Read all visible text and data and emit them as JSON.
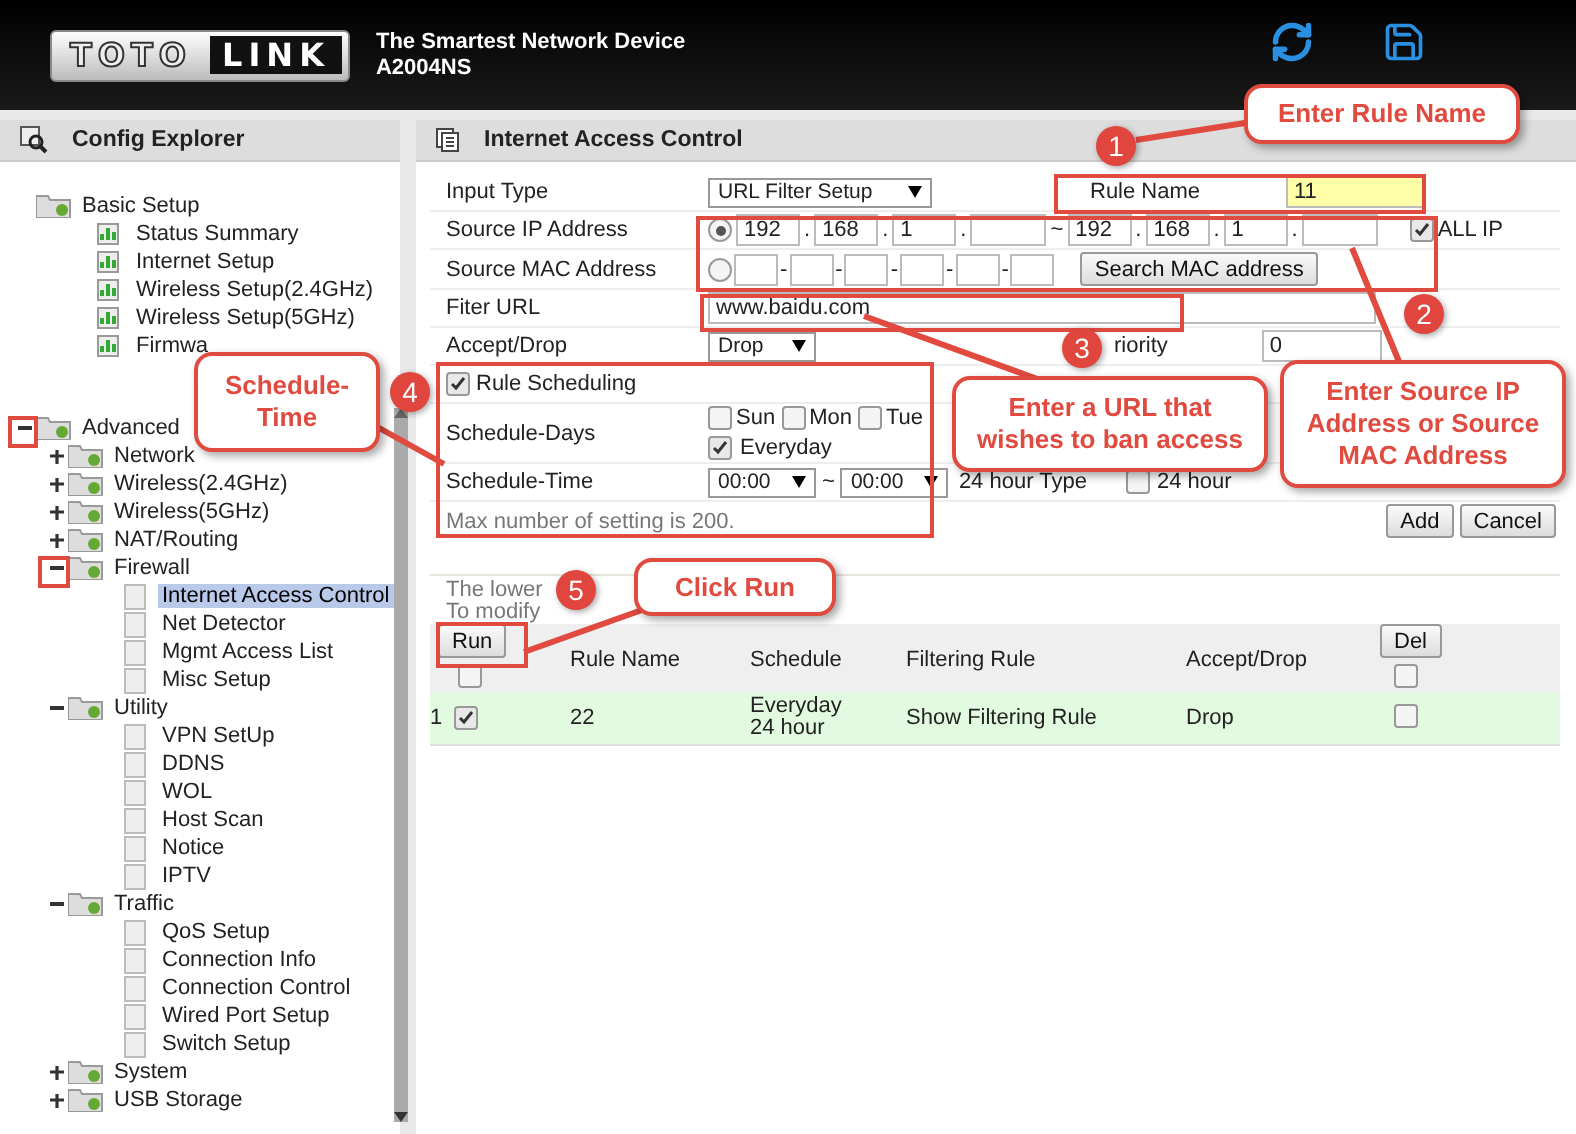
{
  "header": {
    "logo": {
      "left": "TOTO",
      "right": "LINK"
    },
    "tagline": "The Smartest Network Device",
    "model": "A2004NS"
  },
  "sidebar": {
    "title": "Config Explorer",
    "tree": [
      {
        "label": "Basic Setup",
        "kind": "group",
        "selected": false,
        "children": [
          {
            "label": "Status Summary",
            "kind": "item",
            "selected": false
          },
          {
            "label": "Internet Setup",
            "kind": "item",
            "selected": false
          },
          {
            "label": "Wireless Setup(2.4GHz)",
            "kind": "item",
            "selected": false
          },
          {
            "label": "Wireless Setup(5GHz)",
            "kind": "item",
            "selected": false
          },
          {
            "label": "Firmwa",
            "kind": "item",
            "selected": false
          }
        ]
      },
      {
        "label": "Advanced",
        "kind": "group",
        "expanded": true,
        "selected": false,
        "children": [
          {
            "label": "Network",
            "kind": "group",
            "expanded": false,
            "selected": false
          },
          {
            "label": "Wireless(2.4GHz)",
            "kind": "group",
            "expanded": false,
            "selected": false
          },
          {
            "label": "Wireless(5GHz)",
            "kind": "group",
            "expanded": false,
            "selected": false
          },
          {
            "label": "NAT/Routing",
            "kind": "group",
            "expanded": false,
            "selected": false
          },
          {
            "label": "Firewall",
            "kind": "group",
            "expanded": true,
            "selected": false,
            "children": [
              {
                "label": "Internet Access Control",
                "kind": "leaf",
                "selected": true
              },
              {
                "label": "Net Detector",
                "kind": "leaf",
                "selected": false
              },
              {
                "label": "Mgmt Access List",
                "kind": "leaf",
                "selected": false
              },
              {
                "label": "Misc Setup",
                "kind": "leaf",
                "selected": false
              }
            ]
          },
          {
            "label": "Utility",
            "kind": "group",
            "expanded": true,
            "selected": false,
            "children": [
              {
                "label": "VPN SetUp",
                "kind": "leaf",
                "selected": false
              },
              {
                "label": "DDNS",
                "kind": "leaf",
                "selected": false
              },
              {
                "label": "WOL",
                "kind": "leaf",
                "selected": false
              },
              {
                "label": "Host Scan",
                "kind": "leaf",
                "selected": false
              },
              {
                "label": "Notice",
                "kind": "leaf",
                "selected": false
              },
              {
                "label": "IPTV",
                "kind": "leaf",
                "selected": false
              }
            ]
          },
          {
            "label": "Traffic",
            "kind": "group",
            "expanded": true,
            "selected": false,
            "children": [
              {
                "label": "QoS Setup",
                "kind": "leaf",
                "selected": false
              },
              {
                "label": "Connection Info",
                "kind": "leaf",
                "selected": false
              },
              {
                "label": "Connection Control",
                "kind": "leaf",
                "selected": false
              },
              {
                "label": "Wired Port Setup",
                "kind": "leaf",
                "selected": false
              },
              {
                "label": "Switch Setup",
                "kind": "leaf",
                "selected": false
              }
            ]
          },
          {
            "label": "System",
            "kind": "group",
            "expanded": false,
            "selected": false
          },
          {
            "label": "USB Storage",
            "kind": "group",
            "expanded": false,
            "selected": false
          }
        ]
      }
    ]
  },
  "panel": {
    "title": "Internet Access Control",
    "input_type": {
      "label": "Input Type",
      "value": "URL Filter Setup"
    },
    "rule_name": {
      "label": "Rule Name",
      "value": "11"
    },
    "source_ip": {
      "label": "Source IP Address",
      "selected": true,
      "dot": ".",
      "range": "~",
      "start": [
        "192",
        "168",
        "1"
      ],
      "end": [
        "192",
        "168",
        "1"
      ]
    },
    "all_ip": {
      "label": "ALL IP",
      "checked": true
    },
    "source_mac": {
      "label": "Source MAC Address",
      "selected": false,
      "dash": "-",
      "button": "Search MAC address"
    },
    "filter_url": {
      "label": "Fiter URL",
      "value": "www.baidu.com"
    },
    "accept_drop": {
      "label": "Accept/Drop",
      "value": "Drop"
    },
    "priority": {
      "label": "riority",
      "value": "0"
    },
    "rule_scheduling": {
      "label": "Rule Scheduling",
      "checked": true
    },
    "schedule_days": {
      "label": "Schedule-Days",
      "days": [
        {
          "label": "Sun",
          "checked": false
        },
        {
          "label": "Mon",
          "checked": false
        },
        {
          "label": "Tue",
          "checked": false
        }
      ],
      "everyday": {
        "label": "Everyday",
        "checked": true
      }
    },
    "schedule_time": {
      "label": "Schedule-Time",
      "from": "00:00",
      "separator": "~",
      "to": "00:00",
      "type_label": "24 hour Type",
      "hour24": {
        "label": "24 hour",
        "checked": false
      }
    },
    "note": "Max number of setting is 200.",
    "buttons": [
      "Add",
      "Cancel"
    ],
    "hint": [
      "The lower",
      "To modify"
    ],
    "table": {
      "run": "Run",
      "del": "Del",
      "select_all": false,
      "delete_all": false,
      "columns": [
        "Rule Name",
        "Schedule",
        "Filtering Rule",
        "Accept/Drop"
      ],
      "rows": [
        {
          "index": "1",
          "checked": true,
          "rule_name": "22",
          "schedule": [
            "Everyday",
            "24 hour"
          ],
          "filtering_rule": "Show Filtering Rule",
          "action": "Drop",
          "delete": false
        }
      ]
    }
  },
  "annotations": [
    {
      "step": "1",
      "text": "Enter Rule Name"
    },
    {
      "step": "4",
      "text": "Schedule-Time"
    },
    {
      "step": "3",
      "text": "Enter a URL that wishes to ban access"
    },
    {
      "step": "2",
      "text": "Enter Source IP Address or Source MAC Address"
    },
    {
      "step": "5",
      "text": "Click Run"
    }
  ]
}
